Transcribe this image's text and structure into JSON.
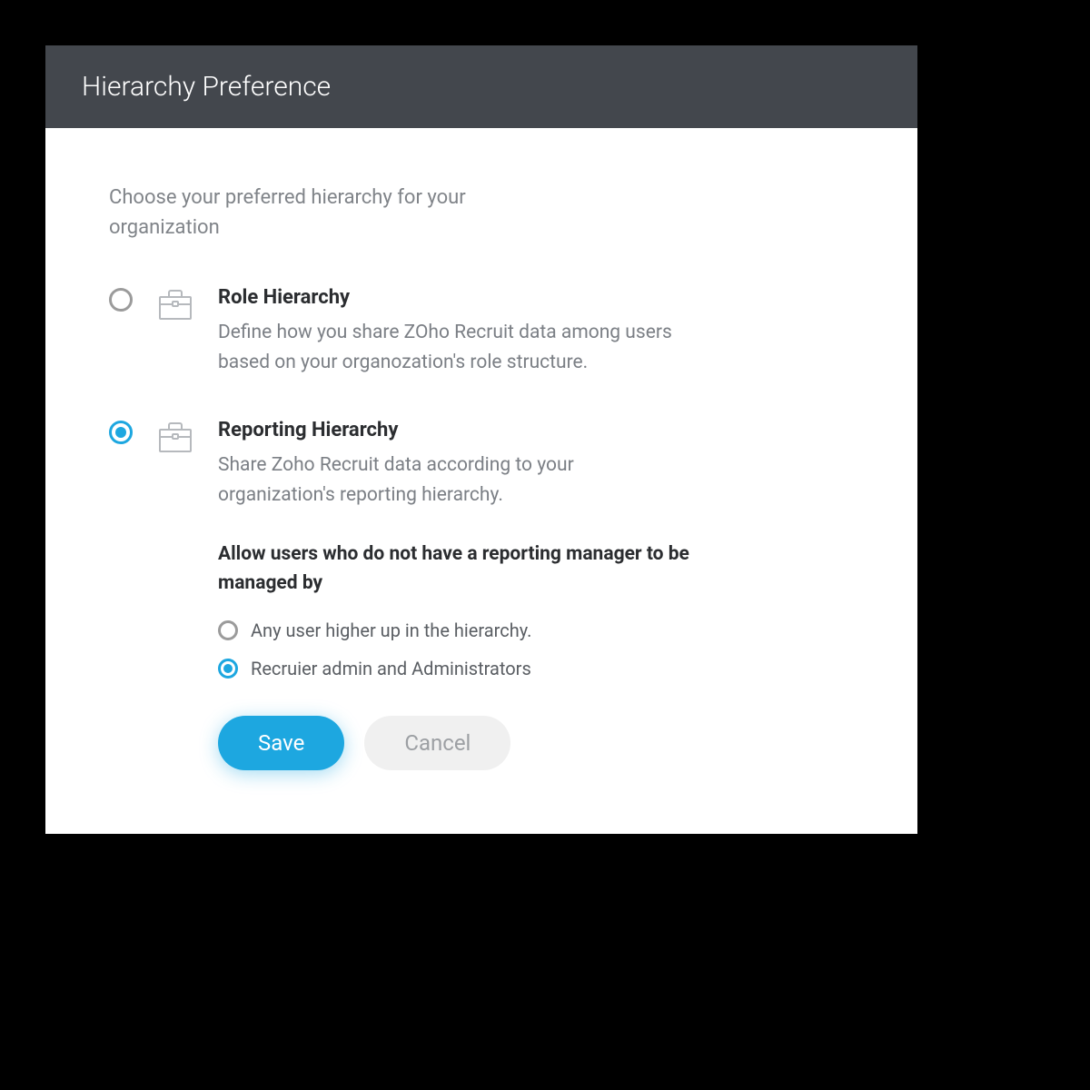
{
  "header": {
    "title": "Hierarchy Preference"
  },
  "intro": "Choose your preferred hierarchy for your organization",
  "options": [
    {
      "title": "Role Hierarchy",
      "desc": "Define how you share ZOho Recruit data among users based on your organozation's role structure.",
      "selected": false
    },
    {
      "title": "Reporting Hierarchy",
      "desc": "Share Zoho Recruit data according to your organization's reporting hierarchy.",
      "selected": true,
      "sub": {
        "heading": "Allow users who do not have a reporting manager to be managed by",
        "choices": [
          {
            "label": "Any user higher up in the hierarchy.",
            "selected": false
          },
          {
            "label": "Recruier admin and Administrators",
            "selected": true
          }
        ]
      }
    }
  ],
  "buttons": {
    "save": "Save",
    "cancel": "Cancel"
  },
  "colors": {
    "accent": "#1da7e0",
    "headerBg": "#43474d"
  }
}
